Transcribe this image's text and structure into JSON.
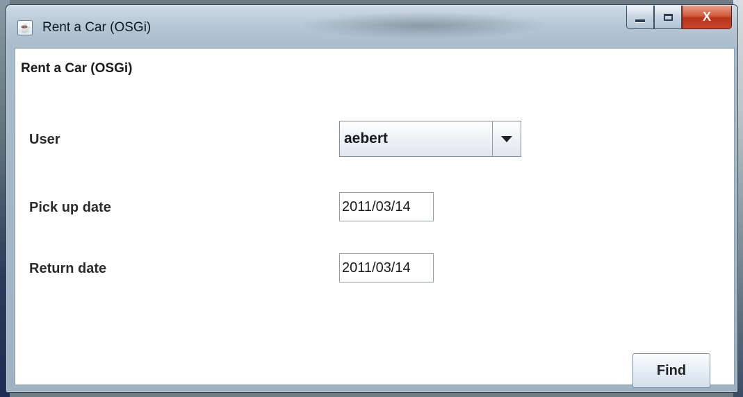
{
  "window": {
    "title": "Rent a Car (OSGi)",
    "icon": "java-cup-icon",
    "controls": {
      "minimize": "minimize-icon",
      "maximize": "maximize-icon",
      "close": "X"
    }
  },
  "form": {
    "heading": "Rent a Car (OSGi)",
    "user": {
      "label": "User",
      "value": "aebert"
    },
    "pickup": {
      "label": "Pick up date",
      "value": "2011/03/14"
    },
    "return_date": {
      "label": "Return date",
      "value": "2011/03/14"
    },
    "find_label": "Find"
  }
}
